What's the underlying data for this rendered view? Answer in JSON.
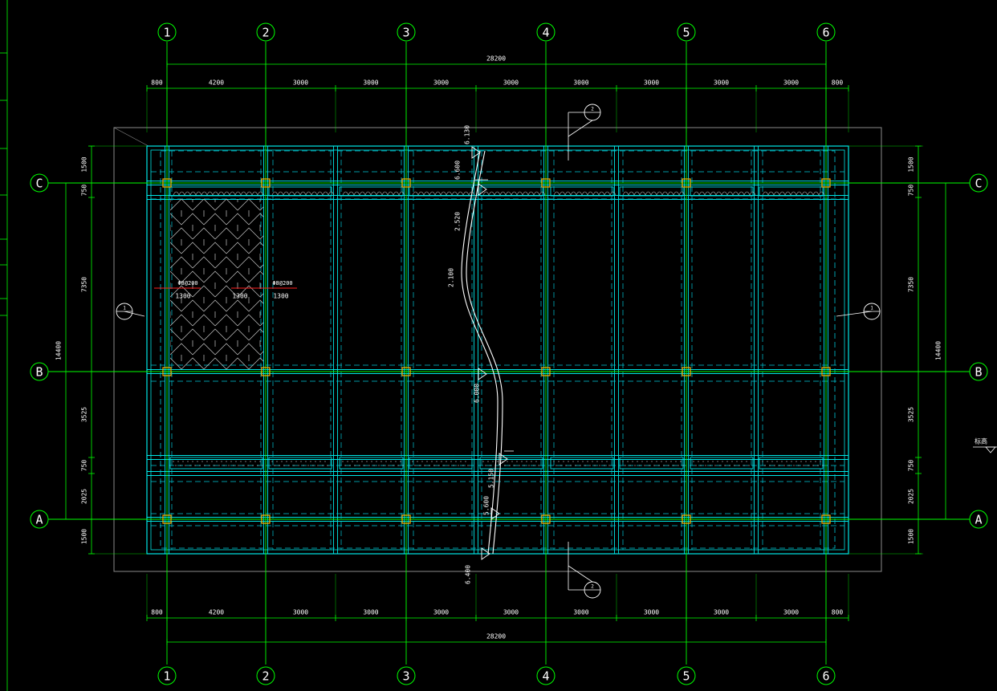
{
  "drawing": {
    "background": "#000000",
    "colors": {
      "axis": "#00ff00",
      "structure": "#00e5e5",
      "hidden": "#00c8d8",
      "column": "#ffb000",
      "section": "#ffffff",
      "red": "#ff2020",
      "gray": "#8a8a8a"
    },
    "column_axes": [
      "1",
      "2",
      "3",
      "4",
      "5",
      "6"
    ],
    "row_axes": [
      "C",
      "B",
      "A"
    ],
    "top_dims": {
      "total": "28200",
      "segments": [
        "800",
        "4200",
        "3000",
        "3000",
        "3000",
        "3000",
        "3000",
        "3000",
        "3000",
        "3000",
        "800"
      ]
    },
    "bottom_dims": {
      "total": "28200",
      "segments": [
        "800",
        "4200",
        "3000",
        "3000",
        "3000",
        "3000",
        "3000",
        "3000",
        "3000",
        "3000",
        "800"
      ]
    },
    "left_dims": {
      "total": "14400",
      "segments": [
        "1500",
        "750",
        "7350",
        "3525",
        "750",
        "2025",
        "1500"
      ]
    },
    "right_dims": {
      "total": "14400",
      "segments": [
        "1500",
        "750",
        "7350",
        "3525",
        "750",
        "2025",
        "1500"
      ]
    },
    "elevations": [
      "6.130",
      "6.600",
      "2.520",
      "2.100",
      "6.000",
      "5.150",
      "5.600",
      "6.400"
    ],
    "rebar_notes": {
      "left_label": "Φ8@200",
      "right_label": "Φ8@200",
      "spans": [
        "1300",
        "1300",
        "1300"
      ]
    },
    "section_marks": [
      "1",
      "1",
      "2",
      "2"
    ],
    "legend_note": "标高"
  }
}
